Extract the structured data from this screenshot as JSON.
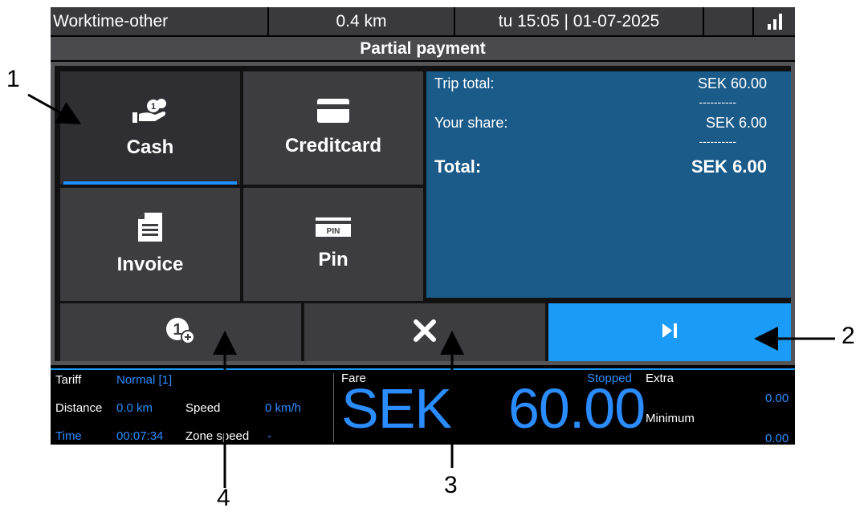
{
  "statusbar": {
    "mode": "Worktime-other",
    "distance": "0.4 km",
    "datetime": "tu 15:05 | 01-07-2025",
    "signal_icon": "signal-bars-icon"
  },
  "title": "Partial payment",
  "payment_methods": [
    {
      "label": "Cash",
      "icon": "cash-hand-coins-icon",
      "selected": true
    },
    {
      "label": "Creditcard",
      "icon": "credit-card-icon",
      "selected": false
    },
    {
      "label": "Invoice",
      "icon": "invoice-document-icon",
      "selected": false
    },
    {
      "label": "Pin",
      "icon": "pin-card-icon",
      "selected": false
    }
  ],
  "summary": {
    "trip_total_label": "Trip total:",
    "trip_total_value": "SEK 60.00",
    "separator": "----------",
    "your_share_label": "Your share:",
    "your_share_value": "SEK 6.00",
    "total_label": "Total:",
    "total_value": "SEK 6.00"
  },
  "actions": {
    "add_passenger_icon": "add-one-passenger-icon",
    "cancel_icon": "close-icon",
    "next_icon": "skip-next-icon"
  },
  "meter": {
    "tariff_label": "Tariff",
    "tariff_value": "Normal [1]",
    "distance_label": "Distance",
    "distance_value": "0.0 km",
    "speed_label": "Speed",
    "speed_value": "0 km/h",
    "time_label": "Time",
    "time_value": "00:07:34",
    "zone_speed_label": "Zone speed",
    "zone_speed_value": "-",
    "fare_label": "Fare",
    "status": "Stopped",
    "currency": "SEK",
    "fare_value": "60.00",
    "extra_label": "Extra",
    "extra_value": "0.00",
    "minimum_label": "Minimum",
    "minimum_value": "0.00"
  },
  "callouts": [
    "1",
    "2",
    "3",
    "4"
  ],
  "colors": {
    "accent": "#1a9bf7",
    "summary_bg": "#1b5b8a",
    "button_bg": "#3d3d40"
  }
}
